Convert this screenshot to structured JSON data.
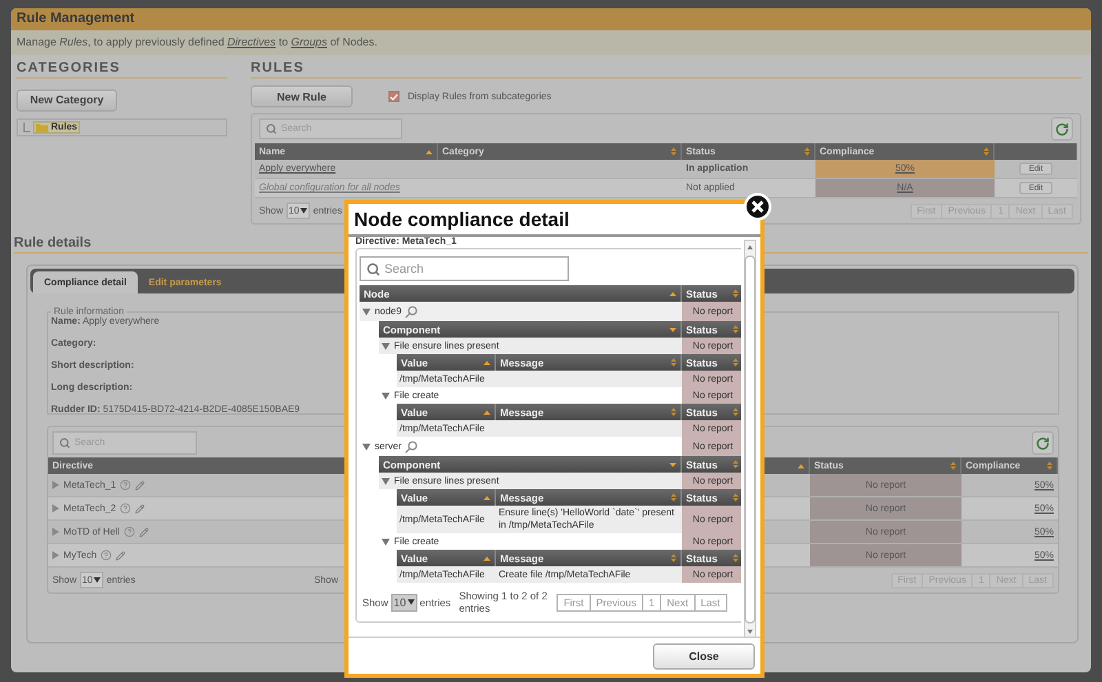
{
  "header": {
    "title": "Rule Management",
    "description": [
      {
        "kind": "text",
        "text": "Manage *Rules*, to apply previously defined "
      },
      {
        "kind": "link",
        "text": "Directives"
      },
      {
        "kind": "text",
        "text": " to "
      },
      {
        "kind": "link",
        "text": "Groups"
      },
      {
        "kind": "text",
        "text": " of Nodes."
      }
    ]
  },
  "categories": {
    "heading": "CATEGORIES",
    "new_button": "New Category",
    "tree": [
      {
        "label": "Rules",
        "selected": true
      }
    ]
  },
  "rules": {
    "heading": "RULES",
    "new_button": "New Rule",
    "subcategories": {
      "label": "Display Rules from subcategories",
      "checked": true
    },
    "search": {
      "placeholder": "Search"
    },
    "columns": [
      {
        "label": "Name",
        "sorted": true,
        "descending": false
      },
      {
        "label": "Category",
        "sorted": false
      },
      {
        "label": "Status",
        "sorted": false
      },
      {
        "label": "Compliance",
        "sorted": false
      }
    ],
    "rows": [
      {
        "name": "Apply everywhere",
        "enabled": true,
        "status": "In application",
        "compliance": "50%",
        "color": "#c29a66",
        "action": "Edit"
      },
      {
        "name": "Global configuration for all nodes",
        "enabled": false,
        "status": "Not applied",
        "compliance": "N/A",
        "color": "#9e9494",
        "action": "Edit"
      }
    ],
    "footer": {
      "show": "Show",
      "page_size": "10",
      "entries": "entries",
      "pagination": [
        "First",
        "Previous",
        "1",
        "Next",
        "Last"
      ]
    }
  },
  "rule_details": {
    "heading": "Rule details",
    "tabs": [
      {
        "label": "Compliance detail",
        "selected": true
      },
      {
        "label": "Edit parameters",
        "selected": false
      }
    ],
    "info": {
      "legend": "Rule information",
      "fields": [
        {
          "label": "Name:",
          "value": "Apply everywhere"
        },
        {
          "label": "Category:"
        },
        {
          "label": "Short description:"
        },
        {
          "label": "Long description:"
        },
        {
          "label": "Rudder ID:",
          "value": "5175D415-BD72-4214-B2DE-4085E150BAE9"
        }
      ]
    },
    "search": {
      "placeholder": "Search"
    },
    "columns": [
      {
        "label": "Directive",
        "sorted": true,
        "descending": false
      },
      {
        "label": "Status",
        "sorted": false
      },
      {
        "label": "Compliance",
        "sorted": false
      }
    ],
    "rows": [
      {
        "name": "MetaTech_1",
        "expanded": false,
        "status": "No report",
        "compliance": "50%"
      },
      {
        "name": "MetaTech_2",
        "expanded": false,
        "status": "No report",
        "compliance": "50%"
      },
      {
        "name": "MoTD of Hell",
        "expanded": false,
        "status": "No report",
        "compliance": "50%"
      },
      {
        "name": "MyTech",
        "expanded": false,
        "status": "No report",
        "compliance": "50%"
      }
    ],
    "footer": {
      "show": "Show",
      "page_size": "10",
      "entries": "entries",
      "info": "Show",
      "pagination": [
        "First",
        "Previous",
        "1",
        "Next",
        "Last"
      ]
    }
  },
  "modal": {
    "title": "Node compliance detail",
    "directive": "Directive: MetaTech_1",
    "search": {
      "placeholder": "Search"
    },
    "columns": [
      {
        "label": "Node",
        "sorted": true,
        "descending": false
      },
      {
        "label": "Status",
        "sorted": false
      }
    ],
    "nodes": [
      {
        "name": "node9",
        "status": "No report",
        "expanded": true,
        "columns": [
          {
            "label": "Component",
            "sorted": true,
            "descending": true
          },
          {
            "label": "Status",
            "sorted": false
          }
        ],
        "components": [
          {
            "name": "File ensure lines present",
            "status": "No report",
            "expanded": true,
            "columns": [
              {
                "label": "Value",
                "sorted": true,
                "descending": false
              },
              {
                "label": "Message",
                "sorted": false
              },
              {
                "label": "Status",
                "sorted": false
              }
            ],
            "values": [
              {
                "value": "/tmp/MetaTechAFile",
                "status": "No report"
              }
            ]
          },
          {
            "name": "File create",
            "status": "No report",
            "expanded": true,
            "columns": [
              {
                "label": "Value",
                "sorted": true,
                "descending": false
              },
              {
                "label": "Message",
                "sorted": false
              },
              {
                "label": "Status",
                "sorted": false
              }
            ],
            "values": [
              {
                "value": "/tmp/MetaTechAFile",
                "status": "No report"
              }
            ]
          }
        ]
      },
      {
        "name": "server",
        "status": "No report",
        "expanded": true,
        "columns": [
          {
            "label": "Component",
            "sorted": true,
            "descending": true
          },
          {
            "label": "Status",
            "sorted": false
          }
        ],
        "components": [
          {
            "name": "File ensure lines present",
            "status": "No report",
            "expanded": true,
            "columns": [
              {
                "label": "Value",
                "sorted": true,
                "descending": false
              },
              {
                "label": "Message",
                "sorted": false
              },
              {
                "label": "Status",
                "sorted": false
              }
            ],
            "values": [
              {
                "value": "/tmp/MetaTechAFile",
                "message": "Ensure line(s) 'HelloWorld `date`' present in /tmp/MetaTechAFile",
                "status": "No report"
              }
            ]
          },
          {
            "name": "File create",
            "status": "No report",
            "expanded": true,
            "columns": [
              {
                "label": "Value",
                "sorted": true,
                "descending": false
              },
              {
                "label": "Message",
                "sorted": false
              },
              {
                "label": "Status",
                "sorted": false
              }
            ],
            "values": [
              {
                "value": "/tmp/MetaTechAFile",
                "message": "Create file /tmp/MetaTechAFile",
                "status": "No report"
              }
            ]
          }
        ]
      }
    ],
    "footer": {
      "show": "Show",
      "page_size": "10",
      "entries": "entries",
      "info": "Showing 1 to 2 of 2 entries",
      "pagination": [
        "First",
        "Previous",
        "1",
        "Next",
        "Last"
      ]
    },
    "close_button": "Close"
  }
}
